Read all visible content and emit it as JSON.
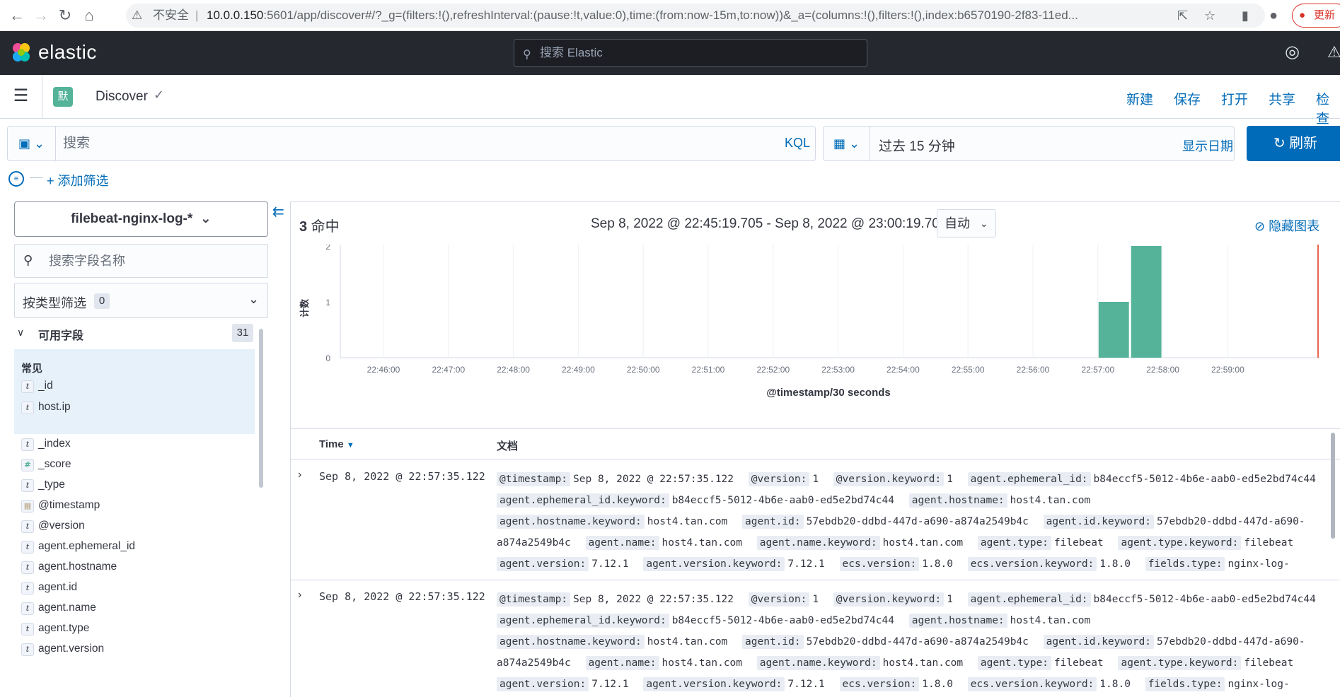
{
  "browser": {
    "insecure_label": "不安全",
    "url_host": "10.0.0.150",
    "url_rest": ":5601/app/discover#/?_g=(filters:!(),refreshInterval:(pause:!t,value:0),time:(from:now-15m,to:now))&_a=(columns:!(),filters:!(),index:b6570190-2f83-11ed...",
    "update_label": "更新"
  },
  "header": {
    "logo_text": "elastic",
    "search_placeholder": "搜索 Elastic"
  },
  "appbar": {
    "space_initial": "默",
    "breadcrumb": "Discover",
    "menu": [
      "新建",
      "保存",
      "打开",
      "共享",
      "检查"
    ]
  },
  "query": {
    "placeholder": "搜索",
    "language": "KQL",
    "time_range": "过去 15 分钟",
    "show_dates": "显示日期",
    "refresh": "刷新",
    "add_filter": "+ 添加筛选"
  },
  "sidebar": {
    "index_pattern": "filebeat-nginx-log-*",
    "field_search_placeholder": "搜索字段名称",
    "type_filter_label": "按类型筛选",
    "type_filter_count": "0",
    "available_label": "可用字段",
    "available_count": "31",
    "popular_label": "常见",
    "popular_fields": [
      {
        "type": "t",
        "name": "_id"
      },
      {
        "type": "t",
        "name": "host.ip"
      }
    ],
    "fields": [
      {
        "type": "t",
        "name": "_index"
      },
      {
        "type": "#",
        "name": "_score"
      },
      {
        "type": "t",
        "name": "_type"
      },
      {
        "type": "date",
        "name": "@timestamp"
      },
      {
        "type": "t",
        "name": "@version"
      },
      {
        "type": "t",
        "name": "agent.ephemeral_id"
      },
      {
        "type": "t",
        "name": "agent.hostname"
      },
      {
        "type": "t",
        "name": "agent.id"
      },
      {
        "type": "t",
        "name": "agent.name"
      },
      {
        "type": "t",
        "name": "agent.type"
      },
      {
        "type": "t",
        "name": "agent.version"
      }
    ]
  },
  "main": {
    "hits_count": "3",
    "hits_label": " 命中",
    "time_span": "Sep 8, 2022 @ 22:45:19.705 - Sep 8, 2022 @ 23:00:19.705",
    "interval": "自动",
    "hide_chart": "隐藏图表",
    "col_time": "Time",
    "col_doc": "文档"
  },
  "chart_data": {
    "type": "bar",
    "xlabel": "@timestamp/30 seconds",
    "ylabel": "计数",
    "ylim": [
      0,
      2
    ],
    "y_ticks": [
      "0",
      "1",
      "2"
    ],
    "x_ticks": [
      "22:46:00",
      "22:47:00",
      "22:48:00",
      "22:49:00",
      "22:50:00",
      "22:51:00",
      "22:52:00",
      "22:53:00",
      "22:54:00",
      "22:55:00",
      "22:56:00",
      "22:57:00",
      "22:58:00",
      "22:59:00"
    ],
    "bars": [
      {
        "start": "22:57:00",
        "value": 1
      },
      {
        "start": "22:57:30",
        "value": 2
      }
    ],
    "colors": {
      "bar": "#54b399",
      "now_line": "#e7664c"
    }
  },
  "documents": [
    {
      "time": "Sep 8, 2022 @ 22:57:35.122",
      "fields": [
        [
          "@timestamp:",
          "Sep 8, 2022 @ 22:57:35.122"
        ],
        [
          "@version:",
          "1"
        ],
        [
          "@version.keyword:",
          "1"
        ],
        [
          "agent.ephemeral_id:",
          "b84eccf5-5012-4b6e-aab0-ed5e2bd74c44"
        ],
        [
          "agent.ephemeral_id.keyword:",
          "b84eccf5-5012-4b6e-aab0-ed5e2bd74c44"
        ],
        [
          "agent.hostname:",
          "host4.tan.com"
        ],
        [
          "agent.hostname.keyword:",
          "host4.tan.com"
        ],
        [
          "agent.id:",
          "57ebdb20-ddbd-447d-a690-a874a2549b4c"
        ],
        [
          "agent.id.keyword:",
          "57ebdb20-ddbd-447d-a690-a874a2549b4c"
        ],
        [
          "agent.name:",
          "host4.tan.com"
        ],
        [
          "agent.name.keyword:",
          "host4.tan.com"
        ],
        [
          "agent.type:",
          "filebeat"
        ],
        [
          "agent.type.keyword:",
          "filebeat"
        ],
        [
          "agent.version:",
          "7.12.1"
        ],
        [
          "agent.version.keyword:",
          "7.12.1"
        ],
        [
          "ecs.version:",
          "1.8.0"
        ],
        [
          "ecs.version.keyword:",
          "1.8.0"
        ],
        [
          "fields.type:",
          "nginx-log-"
        ]
      ]
    },
    {
      "time": "Sep 8, 2022 @ 22:57:35.122",
      "fields": [
        [
          "@timestamp:",
          "Sep 8, 2022 @ 22:57:35.122"
        ],
        [
          "@version:",
          "1"
        ],
        [
          "@version.keyword:",
          "1"
        ],
        [
          "agent.ephemeral_id:",
          "b84eccf5-5012-4b6e-aab0-ed5e2bd74c44"
        ],
        [
          "agent.ephemeral_id.keyword:",
          "b84eccf5-5012-4b6e-aab0-ed5e2bd74c44"
        ],
        [
          "agent.hostname:",
          "host4.tan.com"
        ],
        [
          "agent.hostname.keyword:",
          "host4.tan.com"
        ],
        [
          "agent.id:",
          "57ebdb20-ddbd-447d-a690-a874a2549b4c"
        ],
        [
          "agent.id.keyword:",
          "57ebdb20-ddbd-447d-a690-a874a2549b4c"
        ],
        [
          "agent.name:",
          "host4.tan.com"
        ],
        [
          "agent.name.keyword:",
          "host4.tan.com"
        ],
        [
          "agent.type:",
          "filebeat"
        ],
        [
          "agent.type.keyword:",
          "filebeat"
        ],
        [
          "agent.version:",
          "7.12.1"
        ],
        [
          "agent.version.keyword:",
          "7.12.1"
        ],
        [
          "ecs.version:",
          "1.8.0"
        ],
        [
          "ecs.version.keyword:",
          "1.8.0"
        ],
        [
          "fields.type:",
          "nginx-log-"
        ]
      ]
    }
  ]
}
